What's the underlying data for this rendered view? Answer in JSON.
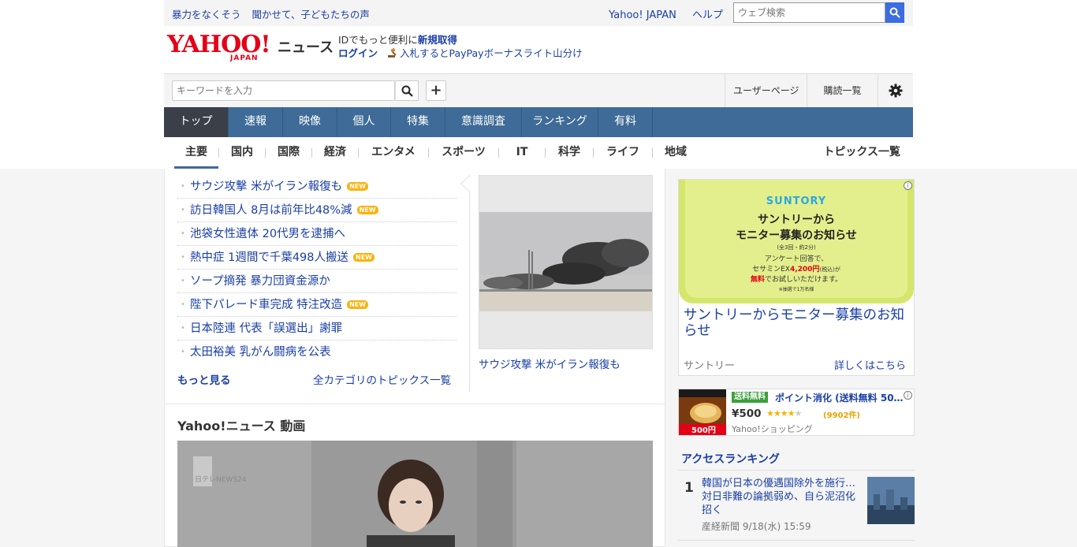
{
  "topbar": {
    "promo1": "暴力をなくそう",
    "promo2": "聞かせて、子どもたちの声",
    "yahoo_link": "Yahoo! JAPAN",
    "help_link": "ヘルプ",
    "search_placeholder": "ウェブ検索"
  },
  "header": {
    "logo_text": "YAHOO!",
    "logo_sub": "JAPAN",
    "service": "ニュース",
    "id_prefix": "IDでもっと便利に",
    "id_signup": "新規取得",
    "login": "ログイン",
    "auction_promo": "入札するとPayPayボーナスライト山分け"
  },
  "search": {
    "placeholder": "キーワードを入力",
    "add": "+",
    "user_page": "ユーザーページ",
    "subscriptions": "購読一覧"
  },
  "main_nav": [
    "トップ",
    "速報",
    "映像",
    "個人",
    "特集",
    "意識調査",
    "ランキング",
    "有料"
  ],
  "sub_nav": [
    "主要",
    "国内",
    "国際",
    "経済",
    "エンタメ",
    "スポーツ",
    "IT",
    "科学",
    "ライフ",
    "地域"
  ],
  "sub_nav_all": "トピックス一覧",
  "topics": [
    {
      "title": "サウジ攻撃 米がイラン報復も",
      "new": "NEW"
    },
    {
      "title": "訪日韓国人 8月は前年比48%減",
      "new": "NEW"
    },
    {
      "title": "池袋女性遺体 20代男を逮捕へ",
      "new": ""
    },
    {
      "title": "熱中症 1週間で千葉498人搬送",
      "new": "NEW"
    },
    {
      "title": "ソープ摘発 暴力団資金源か",
      "new": ""
    },
    {
      "title": "陛下パレード車完成 特注改造",
      "new": "NEW"
    },
    {
      "title": "日本陸連 代表「誤選出」謝罪",
      "new": ""
    },
    {
      "title": "太田裕美 乳がん闘病を公表",
      "new": ""
    }
  ],
  "more": "もっと見る",
  "all_categories": "全カテゴリのトピックス一覧",
  "photo_caption": "サウジ攻撃 米がイラン報復も",
  "video_section_title": "Yahoo!ニュース 動画",
  "video_logo": "日テレNEWS24",
  "ad1": {
    "brand": "SUNTORY",
    "banner_title_1": "サントリーから",
    "banner_title_2": "モニター募集のお知らせ",
    "banner_note": "(全3回・約2分)",
    "banner_line_1": "アンケート回答で、",
    "banner_line_2a": "セサミンEX",
    "banner_price": "4,200円",
    "banner_line_2b": "(税込)が",
    "banner_free": "無料",
    "banner_line_3": "でお試しいただけます。",
    "banner_limit": "※抽選で1万名様",
    "title": "サントリーからモニター募集のお知らせ",
    "source": "サントリー",
    "more": "詳しくはこちら"
  },
  "ad2": {
    "tag": "送料無料",
    "title": "ポイント消化 (送料無料 50…",
    "price": "¥500",
    "rating": 4,
    "count": "(9902件)",
    "shop": "Yahoo!ショッピング",
    "thumb_text": "500円"
  },
  "ranking": {
    "title": "アクセスランキング",
    "items": [
      {
        "rank": "1",
        "title": "韓国が日本の優遇国除外を施行… 対日非難の論拠弱め、自ら泥沼化招く",
        "meta": "産経新聞 9/18(水) 15:59"
      }
    ]
  },
  "colors": {
    "nav_bg": "#3e6b97",
    "nav_active": "#3b3f48",
    "link": "#1a3fa6",
    "logo_red": "#e40016",
    "new_badge": "#fbb20b"
  }
}
